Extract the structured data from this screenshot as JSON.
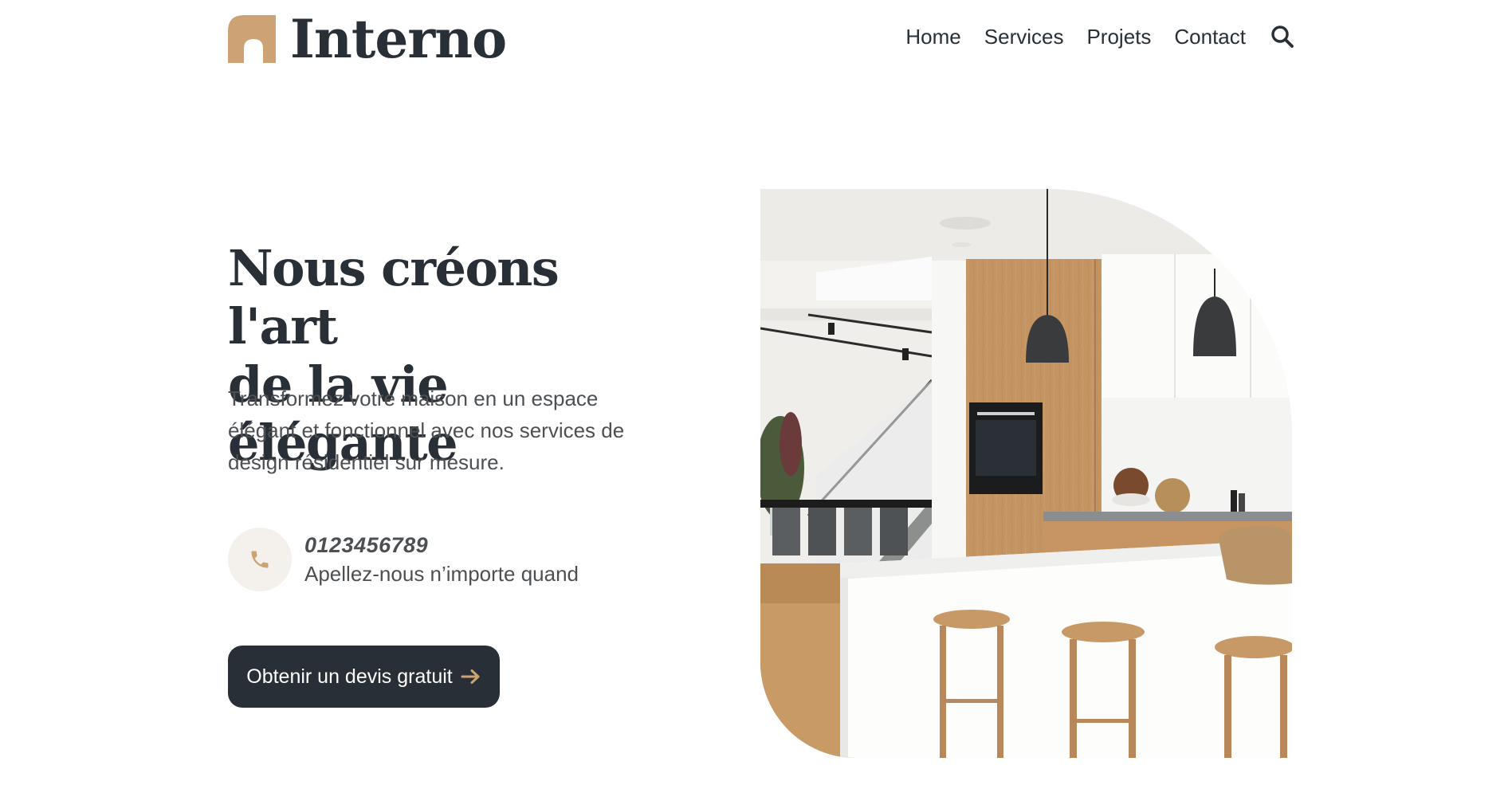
{
  "brand": {
    "name": "Interno",
    "accent_color": "#cda274",
    "dark_color": "#292f36"
  },
  "nav": {
    "items": [
      {
        "label": "Home"
      },
      {
        "label": "Services"
      },
      {
        "label": "Projets"
      },
      {
        "label": "Contact"
      }
    ],
    "search_icon": "search-icon"
  },
  "hero": {
    "title_line1": "Nous créons l'art",
    "title_line2": "de la vie élégante",
    "description_line1": "Transformez votre maison en un espace",
    "description_line2": "élégant et fonctionnel avec nos services de",
    "description_line3": "design résidentiel sur mesure.",
    "contact": {
      "icon": "phone-icon",
      "phone": "0123456789",
      "caption": "Apellez-nous n’importe quand"
    },
    "cta": {
      "label": "Obtenir un devis gratuit",
      "icon": "arrow-right-icon"
    },
    "image": {
      "subject": "kitchen-interior-photo"
    }
  }
}
